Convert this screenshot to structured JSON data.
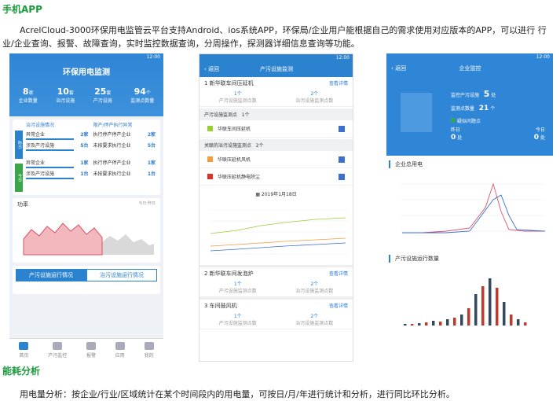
{
  "section1_title": "手机APP",
  "section1_para": "AcrelCloud-3000环保用电监管云平台支持Android、ios系统APP，环保局/企业用户能根据自己的需求使用对应版本的APP，可以进行 行业/企业查询、报警、故障查询，实时监控数据查询，分周操作，探测器详细信息查询等功能。",
  "section2_title": "能耗分析",
  "section2_para": "用电量分析：按企业/行业/区域统计在某个时间段内的用电量，可按日/月/年进行统计和分析，进行同比环比分析。",
  "status_time": "12:00",
  "phone1": {
    "title": "环保用电监测",
    "stats": [
      {
        "num": "8",
        "unit": "家",
        "label": "企业数量"
      },
      {
        "num": "10",
        "unit": "套",
        "label": "治污设施"
      },
      {
        "num": "25",
        "unit": "套",
        "label": "产污设施"
      },
      {
        "num": "94",
        "unit": "个",
        "label": "监测点数量"
      }
    ],
    "col1_hdr": "治污设施情况",
    "col2_hdr": "限产/停产执行异常",
    "side_a": "昨日",
    "side_b": "今日",
    "rows_a": [
      {
        "l1": "异常企业",
        "v1": "2家",
        "l2": "执行停产停产企业",
        "v2": "2家"
      },
      {
        "l1": "涉及产污设施",
        "v1": "5台",
        "l2": "未按要求执行企业",
        "v2": "5台"
      }
    ],
    "rows_b": [
      {
        "l1": "异常企业",
        "v1": "1家",
        "l2": "执行停产停产企业",
        "v2": "1家"
      },
      {
        "l1": "涉及产污设施",
        "v1": "1台",
        "l2": "未按要求执行企业",
        "v2": "1台"
      }
    ],
    "power_label": "功率",
    "legend_today": "今日",
    "legend_yesterday": "昨日",
    "tab_on": "产污设施运行情况",
    "tab_off": "治污设施运行情况",
    "tabbar": [
      "首页",
      "产污监控",
      "报警",
      "应用",
      "我的"
    ]
  },
  "phone2": {
    "back": "返回",
    "title": "产污设施监测",
    "items": [
      {
        "name": "1 新华联车间压延机",
        "link": "查看详情",
        "c1": "1个",
        "c1l": "产污设施监测点数",
        "c2": "2个",
        "c2l": "治污设施监测点数"
      },
      {
        "name": "2 新华联车间发泡炉",
        "link": "查看详情",
        "c1": "1个",
        "c1l": "产污设施监测点数",
        "c2": "2个",
        "c2l": "治污设施监测点数"
      },
      {
        "name": "3 车间鼓风机",
        "link": "查看详情",
        "c1": "1个",
        "c1l": "产污设施监测点数",
        "c2": "2个",
        "c2l": "治污设施监测点数"
      }
    ],
    "grp1": "产污设施监测点",
    "grp1_n": "1个",
    "fac1": "华联车间压延机",
    "grp2": "关联的治污设施监测点",
    "grp2_n": "2个",
    "fac2": "华联压延机风机",
    "fac3": "华联压延机静电除尘",
    "date": "2019年1月18日"
  },
  "phone3": {
    "back": "返回",
    "title": "企业监控",
    "l1": "监控产污设施",
    "v1": "5",
    "u1": "处",
    "l2": "监测点数量",
    "v2": "21",
    "u2": "个",
    "suspect": "疑似问题点",
    "yesterday": "昨日",
    "today": "今日",
    "yv": "0",
    "tv": "0",
    "unit": "处",
    "chart1_title": "企业总用电",
    "chart2_title": "产污设施运行数量"
  }
}
